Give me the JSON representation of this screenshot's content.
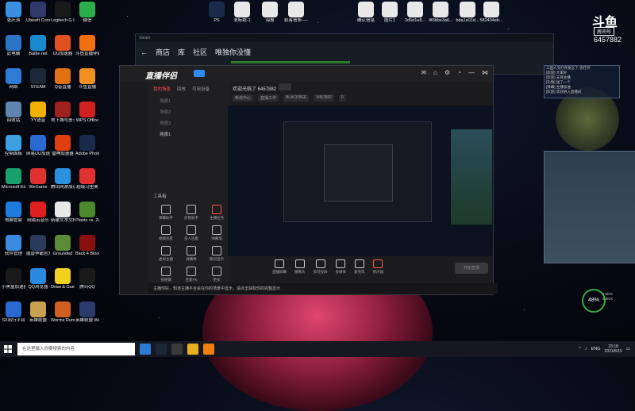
{
  "desktop": {
    "icons": [
      {
        "label": "张庆涛",
        "color": "#3b8fe0"
      },
      {
        "label": "此电脑",
        "color": "#2b73c4"
      },
      {
        "label": "网络",
        "color": "#2f7ad6"
      },
      {
        "label": "回收站",
        "color": "#5f86b0"
      },
      {
        "label": "控制面板",
        "color": "#3ca0e0"
      },
      {
        "label": "Microsoft Edge",
        "color": "#1aa06e"
      },
      {
        "label": "电脑管家",
        "color": "#1e7be0"
      },
      {
        "label": "软件管理",
        "color": "#3a8ae0"
      },
      {
        "label": "小黑盒加速器",
        "color": "#1a1a1a"
      },
      {
        "label": "SX出行平台",
        "color": "#2a6ad0"
      },
      {
        "label": "Ubisoft Connect",
        "color": "#2f3a6a"
      },
      {
        "label": "Battle.net",
        "color": "#1a8ad0"
      },
      {
        "label": "STEAM",
        "color": "#1b2838"
      },
      {
        "label": "YY语音",
        "color": "#f0b000"
      },
      {
        "label": "网易UU加速",
        "color": "#2a6ad0"
      },
      {
        "label": "WeGame",
        "color": "#e03030"
      },
      {
        "label": "网易云音乐",
        "color": "#e02020"
      },
      {
        "label": "魔兽争霸官方对战平台",
        "color": "#2a3a5a"
      },
      {
        "label": "QQ浏览器",
        "color": "#2a8ae0"
      },
      {
        "label": "英雄联盟",
        "color": "#c8a050"
      },
      {
        "label": "Logitech G HUB",
        "color": "#1a1a1a"
      },
      {
        "label": "UU加速器",
        "color": "#e05020"
      },
      {
        "label": "Q音直播",
        "color": "#e07010"
      },
      {
        "label": "地下城与勇士",
        "color": "#a02020"
      },
      {
        "label": "雷神加速器",
        "color": "#e04010"
      },
      {
        "label": "腾讯网游加速器",
        "color": "#2a90e0"
      },
      {
        "label": "新建文本文档",
        "color": "#e8e8e8"
      },
      {
        "label": "Grounded",
        "color": "#5a8a3a"
      },
      {
        "label": "Draw & Guess",
        "color": "#f0d020"
      },
      {
        "label": "Worms Rumble",
        "color": "#d06020"
      },
      {
        "label": "微信",
        "color": "#2aae4a"
      },
      {
        "label": "斗鱼直播伴侣",
        "color": "#f07010"
      },
      {
        "label": "斗鱼直播",
        "color": "#f09020"
      },
      {
        "label": "WPS Office",
        "color": "#d02020"
      },
      {
        "label": "Adobe Photoshop",
        "color": "#1a2a4a"
      },
      {
        "label": "超级马里奥",
        "color": "#e03030"
      },
      {
        "label": "Plants vs. Zombies",
        "color": "#4a8a2a"
      },
      {
        "label": "Back 4 Blood",
        "color": "#8a1010"
      },
      {
        "label": "腾讯QQ",
        "color": "#1a1a1a"
      },
      {
        "label": "英雄联盟 WeGame版",
        "color": "#2a3a6a"
      }
    ],
    "top_files": [
      "PS",
      "未标题-1",
      "海报",
      "刺客信条——介入剪辑",
      "确认信息",
      "图片1",
      "2d5d1e8...",
      "4f6bbe3a6...",
      "bda1e01d...",
      "582404eb...",
      "09c5723..."
    ]
  },
  "steam": {
    "title": "Steam",
    "nav": [
      "商店",
      "库",
      "社区",
      "唯独你没懂"
    ]
  },
  "app": {
    "logo": "直播伴侣",
    "tabs": [
      "我的场景",
      "回放",
      "可用设备"
    ],
    "scenes": [
      "场景1",
      "场景2",
      "场景3",
      "场景1"
    ],
    "tools_title": "工具箱",
    "tools": [
      "弹幕助手",
      "房管助手",
      "主播任务",
      "视频连麦",
      "多人连麦",
      "弹幕墙",
      "虚拟主播",
      "弹幕秀",
      "歌词显示",
      "快捷键",
      "连麦PK",
      "更多"
    ],
    "user_line": "欢迎光临了 6457882",
    "user_btn": "房间",
    "meta": [
      "新增中心",
      "直播工作",
      "BLACKBEE",
      "6457882",
      "0"
    ],
    "controls": [
      "直播屏幕",
      "摄像头",
      "多可投屏",
      "多媒体",
      "麦克风",
      "扬声器"
    ],
    "start_button": "开始直播",
    "notice": "主播你好，知道主播平台会在你的场景中显示，请点击获取你的完整显示"
  },
  "chat": {
    "lines": [
      "三国人叉打开发言了·去打开",
      "[欢迎] 大家好",
      "[欢迎] 支持主播",
      "[礼物] 送了一个",
      "[弹幕] 主播加油",
      "[欢迎] 欢迎进入直播间"
    ]
  },
  "room": {
    "logo": "斗鱼",
    "badge": "房间号",
    "number": "6457882"
  },
  "network": {
    "percent": "48%",
    "up": "7.5K/s",
    "down": "0.2K/s"
  },
  "taskbar": {
    "search_placeholder": "在这里输入你要搜索的内容",
    "apps": [
      "#2a7ad6",
      "#1b2838",
      "#3a3a3a",
      "#e8b020",
      "#f08010"
    ],
    "lang": "ENG",
    "time": "23:18",
    "date": "2021/8/15"
  }
}
